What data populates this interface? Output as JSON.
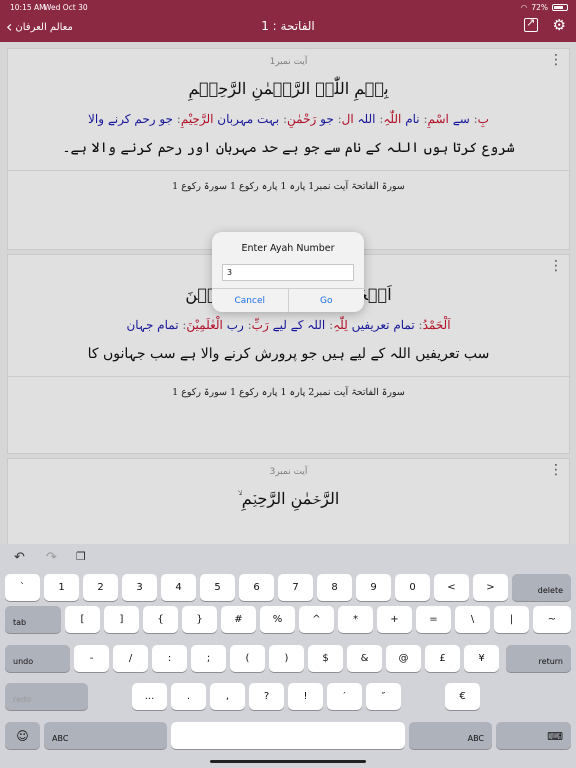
{
  "status": {
    "time": "10:15 AM",
    "date": "Wed Oct 30",
    "battery": "72%"
  },
  "nav": {
    "back_label": "معالم العرفان",
    "title": "الفاتحة : 1"
  },
  "cards": [
    {
      "label": "آیت نمبر1",
      "arabic": "بِسۡمِ اللّٰہِ الرَّحۡمٰنِ الرَّحِیۡمِ",
      "words": [
        {
          "ar": "بِ",
          "ur": "سے"
        },
        {
          "ar": "اسْمِ",
          "ur": "نام"
        },
        {
          "ar": "اللّٰہِ",
          "ur": "اللہ"
        },
        {
          "ar": "ال",
          "ur": "جو"
        },
        {
          "ar": "رَحْمٰنِ",
          "ur": "بہت مہربان"
        },
        {
          "ar": "الرَّحِيْمِ",
          "ur": "جو رحم کرنے والا"
        }
      ],
      "translation": "شروع کرتا ہوں اللہ کے نام سے جو بے حد مہربان اور رحم کرنے والا ہے۔",
      "ref": "سورۃ الفاتحۃ آیت نمبر1 پارہ 1 پارہ رکوع 1 سورۃ رکوع 1"
    },
    {
      "label": "آیت نمبر2",
      "arabic": "اَلۡحَمۡدُ لِلّٰہِ رَبِّ الۡعٰلَمِیۡنَ",
      "words": [
        {
          "ar": "اَلْحَمْدُ",
          "ur": "تمام تعریفیں"
        },
        {
          "ar": "لِلّٰہِ",
          "ur": "اللہ کے لیے"
        },
        {
          "ar": "رَبِّ",
          "ur": "رب"
        },
        {
          "ar": "الْعٰلَمِيْنَ",
          "ur": "تمام جہان"
        }
      ],
      "translation": "سب تعریفیں اللہ کے لیے ہیں جو پرورش کرنے والا ہے سب جہانوں کا",
      "ref": "سورۃ الفاتحۃ آیت نمبر2 پارہ 1 پارہ رکوع 1 سورۃ رکوع 1"
    },
    {
      "label": "آیت نمبر3",
      "arabic": "الرَّحۡمٰنِ الرَّحِیۡمِ ۙ",
      "words": [],
      "translation": "",
      "ref": ""
    }
  ],
  "dialog": {
    "title": "Enter Ayah Number",
    "value": "3",
    "cancel": "Cancel",
    "go": "Go"
  },
  "keyboard": {
    "row1": [
      "`",
      "1",
      "2",
      "3",
      "4",
      "5",
      "6",
      "7",
      "8",
      "9",
      "0",
      "<",
      ">"
    ],
    "delete": "delete",
    "tab": "tab",
    "row2": [
      "[",
      "]",
      "{",
      "}",
      "#",
      "%",
      "^",
      "*",
      "+",
      "=",
      "\\",
      "|",
      "~"
    ],
    "undo": "undo",
    "row3": [
      "-",
      "/",
      ":",
      ";",
      "(",
      ")",
      "$",
      "&",
      "@",
      "£",
      "¥"
    ],
    "return": "return",
    "redo": "redo",
    "row4": [
      "...",
      ".",
      ",",
      "?",
      "!",
      "′",
      "″",
      "€"
    ],
    "abc": "ABC"
  }
}
